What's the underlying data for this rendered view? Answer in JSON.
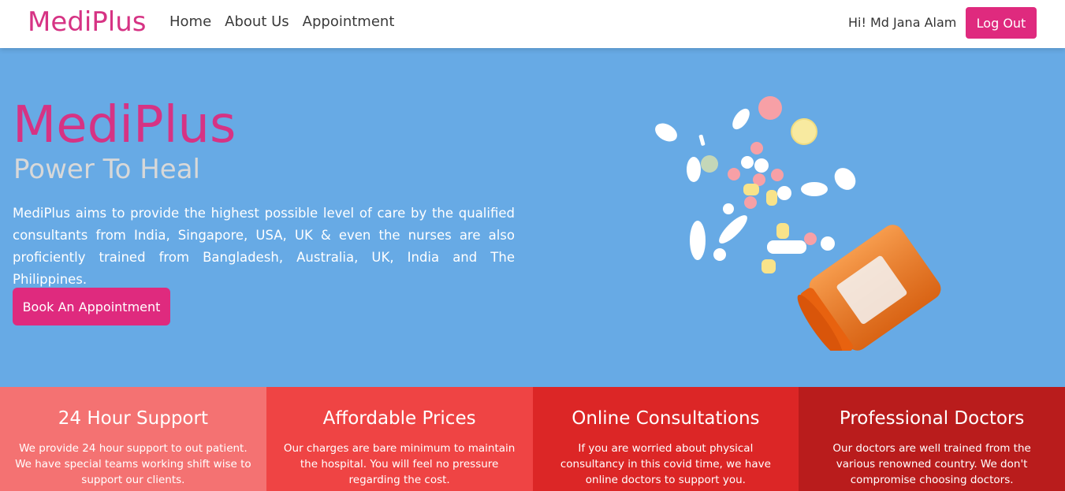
{
  "navbar": {
    "brand": "MediPlus",
    "links": [
      "Home",
      "About Us",
      "Appointment"
    ],
    "greeting": "Hi! Md Jana Alam",
    "logout_label": "Log Out"
  },
  "hero": {
    "title": "MediPlus",
    "subtitle": "Power To Heal",
    "description": "MediPlus aims to provide the highest possible level of care by the qualified consultants from India, Singapore, USA, UK & even the nurses are also proficiently trained from Bangladesh, Australia, UK, India and The Philippines.",
    "cta_label": "Book An Appointment"
  },
  "features": [
    {
      "title": "24 Hour Support",
      "text": "We provide 24 hour support to out patient. We have special teams working shift wise to support our clients.",
      "color": "#f47272"
    },
    {
      "title": "Affordable Prices",
      "text": "Our charges are bare minimum to maintain the hospital. You will feel no pressure regarding the cost.",
      "color": "#ef4444"
    },
    {
      "title": "Online Consultations",
      "text": "If you are worried about physical consultancy in this covid time, we have online doctors to support you.",
      "color": "#dc2626"
    },
    {
      "title": "Professional Doctors",
      "text": "Our doctors are well trained from the various renowned country. We don't compromise choosing doctors.",
      "color": "#b91c1c"
    }
  ],
  "colors": {
    "accent": "#df2a7e",
    "hero_bg": "#67aae5"
  }
}
